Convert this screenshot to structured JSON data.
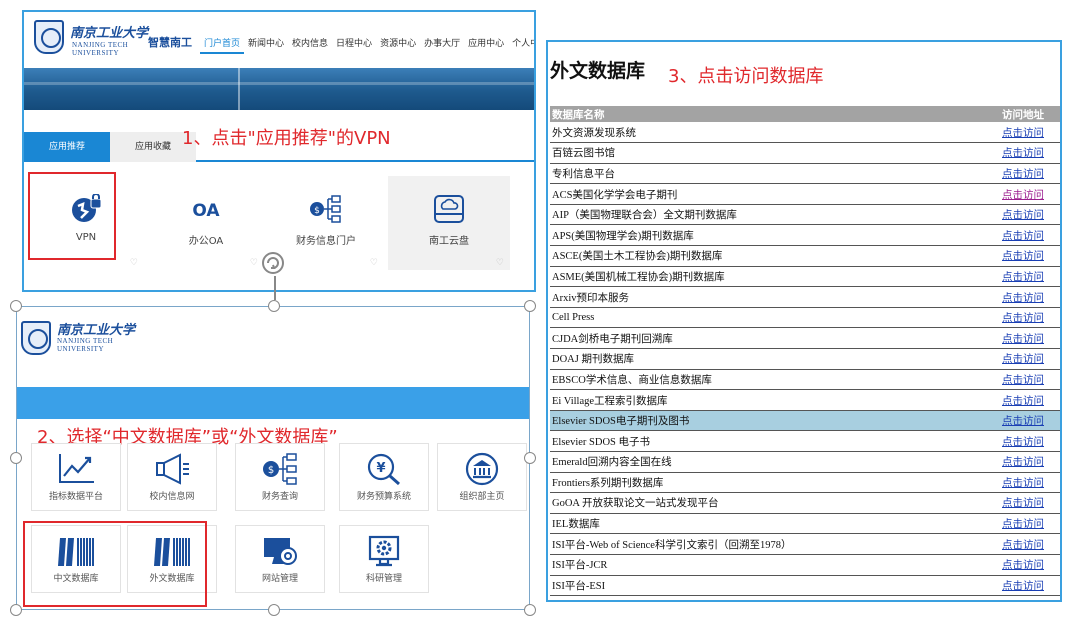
{
  "panel1": {
    "university_cn": "南京工业大学",
    "university_en_1": "NANJING TECH",
    "university_en_2": "UNIVERSITY",
    "brand": "智慧南工",
    "nav": [
      "门户首页",
      "新闻中心",
      "校内信息",
      "日程中心",
      "资源中心",
      "办事大厅",
      "应用中心",
      "个人中心"
    ],
    "tabs": {
      "active": "应用推荐",
      "inactive": "应用收藏"
    },
    "annotation": "1、点击\"应用推荐\"的VPN",
    "apps": [
      {
        "label": "VPN",
        "icon": "vpn-cloud-lock-icon"
      },
      {
        "label": "办公OA",
        "icon": "oa-text-icon"
      },
      {
        "label": "财务信息门户",
        "icon": "finance-portal-icon"
      },
      {
        "label": "南工云盘",
        "icon": "cloud-drive-icon"
      }
    ],
    "heart": "♡"
  },
  "panel2": {
    "university_cn": "南京工业大学",
    "university_en_1": "NANJING TECH",
    "university_en_2": "UNIVERSITY",
    "annotation": "2、选择“中文数据库”或“外文数据库”",
    "tiles_row1": [
      {
        "label": "指标数据平台",
        "icon": "trend-chart-icon"
      },
      {
        "label": "校内信息网",
        "icon": "megaphone-icon"
      },
      {
        "label": "财务查询",
        "icon": "finance-query-icon"
      },
      {
        "label": "财务预算系统",
        "icon": "yuan-search-icon"
      },
      {
        "label": "组织部主页",
        "icon": "institution-icon"
      }
    ],
    "tiles_row2": [
      {
        "label": "中文数据库",
        "icon": "books-barcode-icon"
      },
      {
        "label": "外文数据库",
        "icon": "books-barcode-icon"
      },
      {
        "label": "网站管理",
        "icon": "monitor-gear-icon"
      },
      {
        "label": "科研管理",
        "icon": "monitor-gear-icon"
      }
    ]
  },
  "panel3": {
    "title": "外文数据库",
    "annotation": "3、点击访问数据库",
    "col_name": "数据库名称",
    "col_link": "访问地址",
    "link_text": "点击访问",
    "rows": [
      "外文资源发现系统",
      "百链云图书馆",
      "专利信息平台",
      "ACS美国化学学会电子期刊",
      "AIP（美国物理联合会）全文期刊数据库",
      "APS(美国物理学会)期刊数据库",
      "ASCE(美国土木工程协会)期刊数据库",
      "ASME(美国机械工程协会)期刊数据库",
      "Arxiv预印本服务",
      "Cell Press",
      "CJDA剑桥电子期刊回溯库",
      "DOAJ 期刊数据库",
      "EBSCO学术信息、商业信息数据库",
      "Ei Village工程索引数据库",
      "Elsevier SDOS电子期刊及图书",
      "Elsevier SDOS 电子书",
      "Emerald回溯内容全国在线",
      "Frontiers系列期刊数据库",
      "GoOA 开放获取论文一站式发现平台",
      "IEL数据库",
      "ISI平台-Web of Science科学引文索引（回溯至1978）",
      "ISI平台-JCR",
      "ISI平台-ESI"
    ],
    "visited_row": 3,
    "highlight_row": 14
  },
  "colors": {
    "accent": "#1a87d4",
    "annotation": "#e0282c",
    "link": "#1a3fb4",
    "visited": "#9b1f8f"
  }
}
